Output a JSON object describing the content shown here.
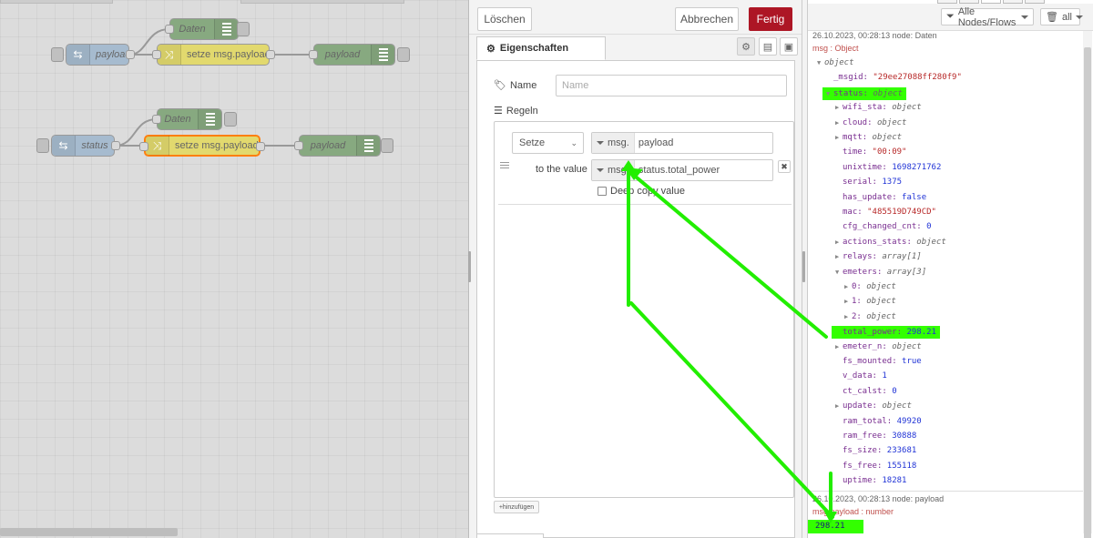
{
  "flow": {
    "nodes": [
      {
        "id": "n1",
        "type": "debug",
        "label": "Daten",
        "italic": true
      },
      {
        "id": "n2",
        "type": "inject",
        "label": "payload",
        "italic": true
      },
      {
        "id": "n3",
        "type": "change",
        "label": "setze msg.payload",
        "italic": false
      },
      {
        "id": "n4",
        "type": "debug",
        "label": "payload",
        "italic": true
      },
      {
        "id": "n5",
        "type": "debug",
        "label": "Daten",
        "italic": true
      },
      {
        "id": "n6",
        "type": "inject",
        "label": "status",
        "italic": true
      },
      {
        "id": "n7",
        "type": "change",
        "label": "setze msg.payload",
        "italic": false,
        "selected": true
      },
      {
        "id": "n8",
        "type": "debug",
        "label": "payload",
        "italic": true
      }
    ]
  },
  "tray": {
    "delete_label": "Löschen",
    "cancel_label": "Abbrechen",
    "done_label": "Fertig",
    "tab_properties": "Eigenschaften",
    "name_label": "Name",
    "name_placeholder": "Name",
    "rules_label": "Regeln",
    "rule": {
      "action": "Setze",
      "prop_prefix": "msg.",
      "prop_value": "payload",
      "to_value_label": "to the value",
      "value_prefix": "msg.",
      "value": "status.total_power",
      "deep_copy_label": "Deep copy value",
      "remove_symbol": "✖"
    },
    "add_label": "hinzufügen"
  },
  "sidebar": {
    "filter_label": "Alle Nodes/Flows",
    "clear_label": "all",
    "messages": [
      {
        "meta": "26.10.2023, 00:28:13   node: Daten",
        "path": "msg : Object",
        "tree": [
          {
            "indent": 0,
            "tri": "▼",
            "key": "",
            "sep": "",
            "value": "object",
            "vtype": "obj"
          },
          {
            "indent": 1,
            "tri": "",
            "key": "_msgid",
            "sep": ": ",
            "value": "\"29ee27088ff280f9\"",
            "vtype": "str"
          },
          {
            "indent": 1,
            "tri": "▼",
            "key": "status",
            "sep": ": ",
            "value": "object",
            "vtype": "obj",
            "hl": true
          },
          {
            "indent": 2,
            "tri": "▶",
            "key": "wifi_sta",
            "sep": ": ",
            "value": "object",
            "vtype": "obj"
          },
          {
            "indent": 2,
            "tri": "▶",
            "key": "cloud",
            "sep": ": ",
            "value": "object",
            "vtype": "obj"
          },
          {
            "indent": 2,
            "tri": "▶",
            "key": "mqtt",
            "sep": ": ",
            "value": "object",
            "vtype": "obj"
          },
          {
            "indent": 2,
            "tri": "",
            "key": "time",
            "sep": ": ",
            "value": "\"00:09\"",
            "vtype": "str"
          },
          {
            "indent": 2,
            "tri": "",
            "key": "unixtime",
            "sep": ": ",
            "value": "1698271762",
            "vtype": "num"
          },
          {
            "indent": 2,
            "tri": "",
            "key": "serial",
            "sep": ": ",
            "value": "1375",
            "vtype": "num"
          },
          {
            "indent": 2,
            "tri": "",
            "key": "has_update",
            "sep": ": ",
            "value": "false",
            "vtype": "bool"
          },
          {
            "indent": 2,
            "tri": "",
            "key": "mac",
            "sep": ": ",
            "value": "\"485519D749CD\"",
            "vtype": "str"
          },
          {
            "indent": 2,
            "tri": "",
            "key": "cfg_changed_cnt",
            "sep": ": ",
            "value": "0",
            "vtype": "num"
          },
          {
            "indent": 2,
            "tri": "▶",
            "key": "actions_stats",
            "sep": ": ",
            "value": "object",
            "vtype": "obj"
          },
          {
            "indent": 2,
            "tri": "▶",
            "key": "relays",
            "sep": ": ",
            "value": "array[1]",
            "vtype": "obj"
          },
          {
            "indent": 2,
            "tri": "▼",
            "key": "emeters",
            "sep": ": ",
            "value": "array[3]",
            "vtype": "obj"
          },
          {
            "indent": 3,
            "tri": "▶",
            "key": "0",
            "sep": ": ",
            "value": "object",
            "vtype": "obj"
          },
          {
            "indent": 3,
            "tri": "▶",
            "key": "1",
            "sep": ": ",
            "value": "object",
            "vtype": "obj"
          },
          {
            "indent": 3,
            "tri": "▶",
            "key": "2",
            "sep": ": ",
            "value": "object",
            "vtype": "obj"
          },
          {
            "indent": 2,
            "tri": "",
            "key": "total_power",
            "sep": ": ",
            "value": "298.21",
            "vtype": "num",
            "hl": true
          },
          {
            "indent": 2,
            "tri": "▶",
            "key": "emeter_n",
            "sep": ": ",
            "value": "object",
            "vtype": "obj"
          },
          {
            "indent": 2,
            "tri": "",
            "key": "fs_mounted",
            "sep": ": ",
            "value": "true",
            "vtype": "bool"
          },
          {
            "indent": 2,
            "tri": "",
            "key": "v_data",
            "sep": ": ",
            "value": "1",
            "vtype": "num"
          },
          {
            "indent": 2,
            "tri": "",
            "key": "ct_calst",
            "sep": ": ",
            "value": "0",
            "vtype": "num"
          },
          {
            "indent": 2,
            "tri": "▶",
            "key": "update",
            "sep": ": ",
            "value": "object",
            "vtype": "obj"
          },
          {
            "indent": 2,
            "tri": "",
            "key": "ram_total",
            "sep": ": ",
            "value": "49920",
            "vtype": "num"
          },
          {
            "indent": 2,
            "tri": "",
            "key": "ram_free",
            "sep": ": ",
            "value": "30888",
            "vtype": "num"
          },
          {
            "indent": 2,
            "tri": "",
            "key": "fs_size",
            "sep": ": ",
            "value": "233681",
            "vtype": "num"
          },
          {
            "indent": 2,
            "tri": "",
            "key": "fs_free",
            "sep": ": ",
            "value": "155118",
            "vtype": "num"
          },
          {
            "indent": 2,
            "tri": "",
            "key": "uptime",
            "sep": ": ",
            "value": "18281",
            "vtype": "num"
          }
        ]
      },
      {
        "meta": "26.10.2023, 00:28:13   node: payload",
        "path": "msg.payload : number",
        "value": "298.21"
      }
    ]
  },
  "colors": {
    "highlight": "#33ff00",
    "done_button": "#ad1625",
    "inject_node": "#a6bbcf",
    "change_node": "#e2d96e",
    "debug_node": "#87a980",
    "selected_border": "#ff7f0e"
  }
}
